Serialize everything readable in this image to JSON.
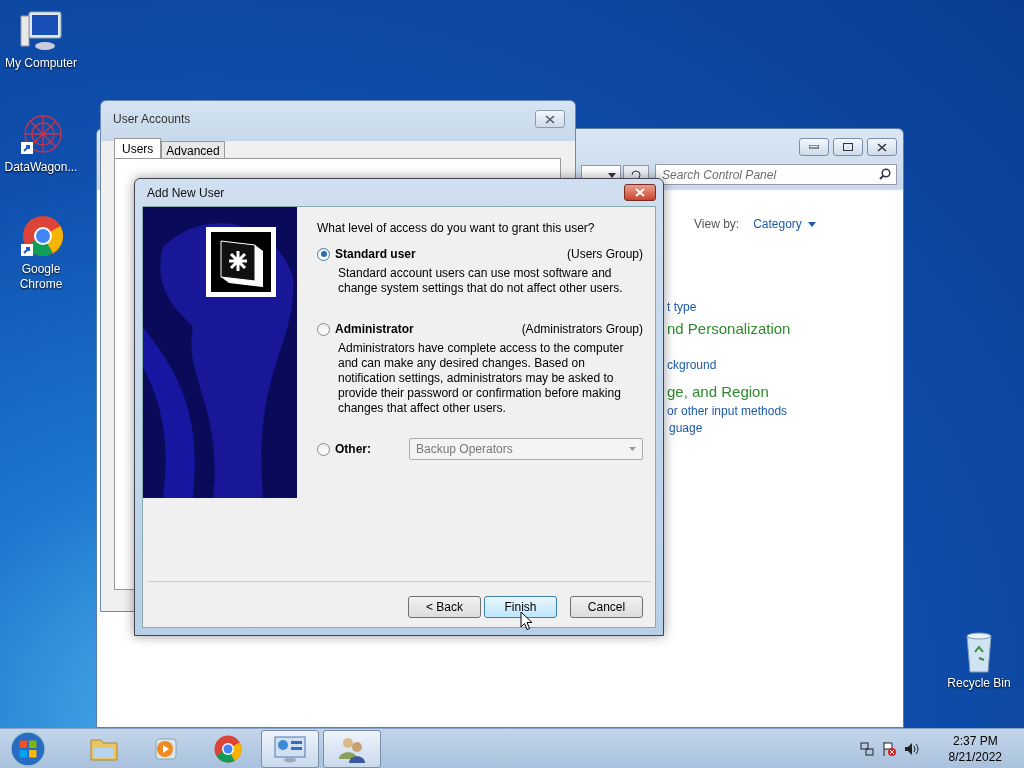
{
  "desktop_icons": [
    {
      "label": "My Computer",
      "kind": "computer",
      "shortcut": false
    },
    {
      "label": "DataWagon...",
      "kind": "web",
      "shortcut": true
    },
    {
      "label": "Google Chrome",
      "kind": "chrome",
      "shortcut": true
    },
    {
      "label": "Recycle Bin",
      "kind": "recycle",
      "shortcut": false
    }
  ],
  "control_panel": {
    "search": {
      "placeholder": "Search Control Panel"
    },
    "view_by": {
      "label": "View by:",
      "value": "Category"
    },
    "links": [
      {
        "text": "t type",
        "kind": "link"
      },
      {
        "text": "nd Personalization",
        "kind": "heading"
      },
      {
        "text": "ckground",
        "kind": "link"
      },
      {
        "text": "ge, and Region",
        "kind": "heading"
      },
      {
        "text": "or other input methods",
        "kind": "link"
      },
      {
        "text": "guage",
        "kind": "link"
      }
    ]
  },
  "user_accounts": {
    "title": "User Accounts",
    "tabs": [
      {
        "label": "Users",
        "selected": true
      },
      {
        "label": "Advanced",
        "selected": false
      }
    ]
  },
  "add_user": {
    "title": "Add New User",
    "question": "What level of access do you want to grant this user?",
    "options": [
      {
        "label": "Standard user",
        "group": "(Users Group)",
        "description": "Standard account users can use most software and change system settings that do not affect other users.",
        "selected": true
      },
      {
        "label": "Administrator",
        "group": "(Administrators Group)",
        "description": "Administrators have complete access to the computer and can make any desired changes. Based on notification settings, administrators may be asked to provide their password or confirmation before making changes that affect other users.",
        "selected": false
      },
      {
        "label": "Other:",
        "dropdown": "Backup Operators",
        "selected": false
      }
    ],
    "dropdown_disabled": true,
    "buttons": [
      {
        "label": "< Back",
        "hover": false
      },
      {
        "label": "Finish",
        "hover": true
      },
      {
        "label": "Cancel",
        "hover": false
      }
    ]
  },
  "taskbar": {
    "apps": [
      {
        "kind": "folder",
        "active": false
      },
      {
        "kind": "media",
        "active": false
      },
      {
        "kind": "chrome",
        "active": false
      },
      {
        "kind": "control",
        "active": true
      },
      {
        "kind": "users",
        "active": true
      }
    ],
    "clock": {
      "time": "2:37 PM",
      "date": "8/21/2022"
    }
  }
}
